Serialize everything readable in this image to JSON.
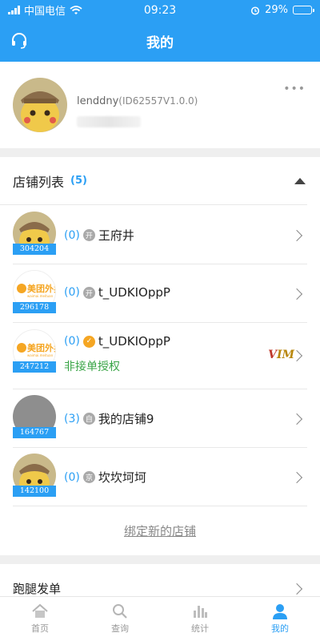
{
  "status_bar": {
    "carrier": "中国电信",
    "time": "09:23",
    "battery_percent": "29%",
    "battery_level": 0.29
  },
  "header": {
    "title": "我的"
  },
  "profile": {
    "username": "lenddny",
    "user_id": "(ID62557V1.0.0)",
    "more_label": "•••"
  },
  "stores": {
    "title": "店铺列表",
    "count": "(5)",
    "items": [
      {
        "badge": "304204",
        "count": "(0)",
        "tag": "开",
        "name": "王府井",
        "avatar": "pikachu"
      },
      {
        "badge": "296178",
        "count": "(0)",
        "tag": "开",
        "name": "t_UDKIOppP",
        "avatar": "meituan"
      },
      {
        "badge": "247212",
        "count": "(0)",
        "tag": "✓",
        "name": "t_UDKIOppP",
        "avatar": "meituan",
        "sub": "非接单授权",
        "vim_v": "V",
        "vim_im": "IM"
      },
      {
        "badge": "164767",
        "count": "(3)",
        "tag": "自",
        "name": "我的店铺9",
        "avatar": "gray"
      },
      {
        "badge": "142100",
        "count": "(0)",
        "tag": "京",
        "name": "坎坎坷坷",
        "avatar": "pikachu"
      }
    ],
    "bind_new": "绑定新的店铺"
  },
  "errand": {
    "label": "跑腿发单"
  },
  "tabbar": {
    "items": [
      {
        "label": "首页",
        "icon": "home-icon"
      },
      {
        "label": "查询",
        "icon": "search-icon"
      },
      {
        "label": "统计",
        "icon": "stats-icon"
      },
      {
        "label": "我的",
        "icon": "person-icon"
      }
    ],
    "active_color": "#2b9ff4"
  },
  "colors": {
    "brand": "#2b9ff4",
    "auth_text": "#3aa547"
  }
}
